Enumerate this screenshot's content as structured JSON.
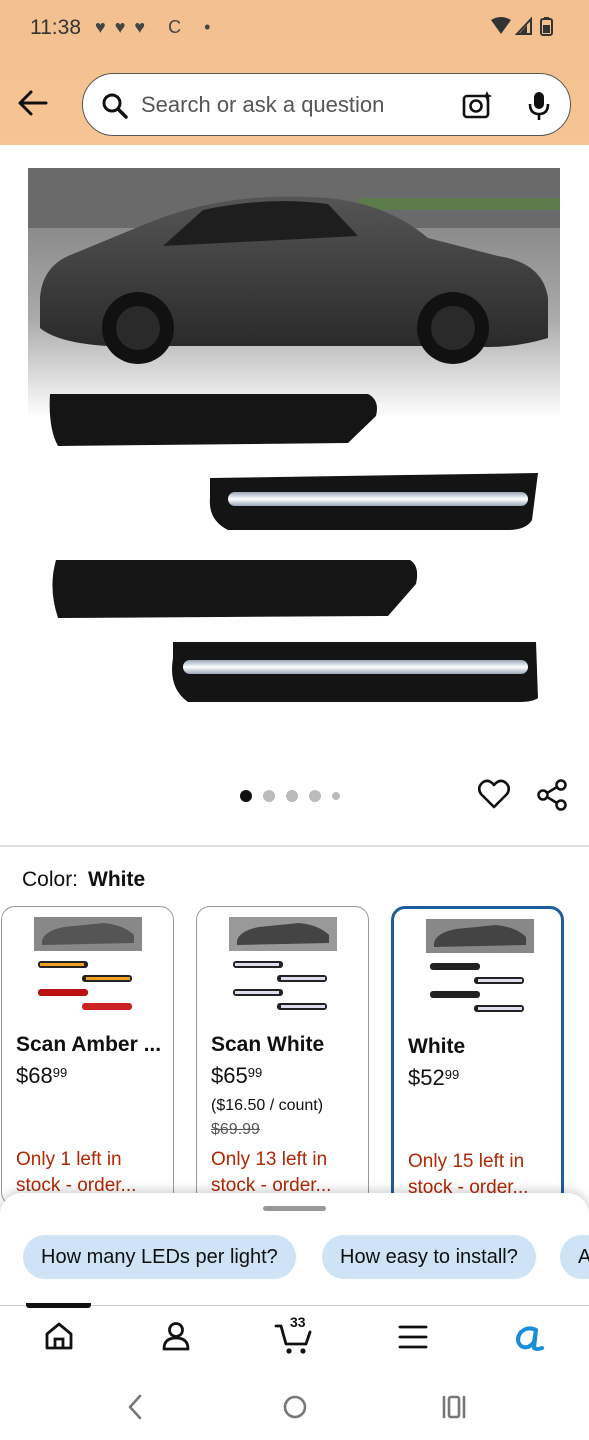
{
  "status_bar": {
    "time": "11:38",
    "left_icons": [
      "heart-icon",
      "heart-icon",
      "heart-icon",
      "c-icon",
      "dot-icon"
    ],
    "right_icons": [
      "wifi-icon",
      "signal-icon",
      "battery-icon"
    ]
  },
  "header": {
    "search_placeholder": "Search or ask a question"
  },
  "gallery": {
    "dot_count": 5,
    "active_dot": 1
  },
  "product": {
    "color_label": "Color:",
    "color_value": "White"
  },
  "variants": [
    {
      "name": "Scan Amber ...",
      "price_whole": "$68",
      "price_fraction": "99",
      "unit_price": "",
      "list_price": "",
      "stock": "Only 1 left in stock - order...",
      "selected": false
    },
    {
      "name": "Scan White",
      "price_whole": "$65",
      "price_fraction": "99",
      "unit_price": "($16.50 / count)",
      "list_price": "$69.99",
      "stock": "Only 13 left in stock - order...",
      "selected": false
    },
    {
      "name": "White",
      "price_whole": "$52",
      "price_fraction": "99",
      "unit_price": "",
      "list_price": "",
      "stock": "Only 15 left in stock - order...",
      "selected": true
    }
  ],
  "suggestions": [
    "How many LEDs per light?",
    "How easy to install?",
    "A"
  ],
  "bottom_nav": {
    "items": [
      "home-icon",
      "account-icon",
      "cart-icon",
      "menu-icon",
      "rufus-icon"
    ],
    "cart_count": "33"
  },
  "colors": {
    "header_bg": "#f6c594",
    "selected_border": "#1d5d9b",
    "stock_red": "#b12704",
    "chip_bg": "#cfe3f7",
    "rufus_blue": "#1a8cd8"
  }
}
